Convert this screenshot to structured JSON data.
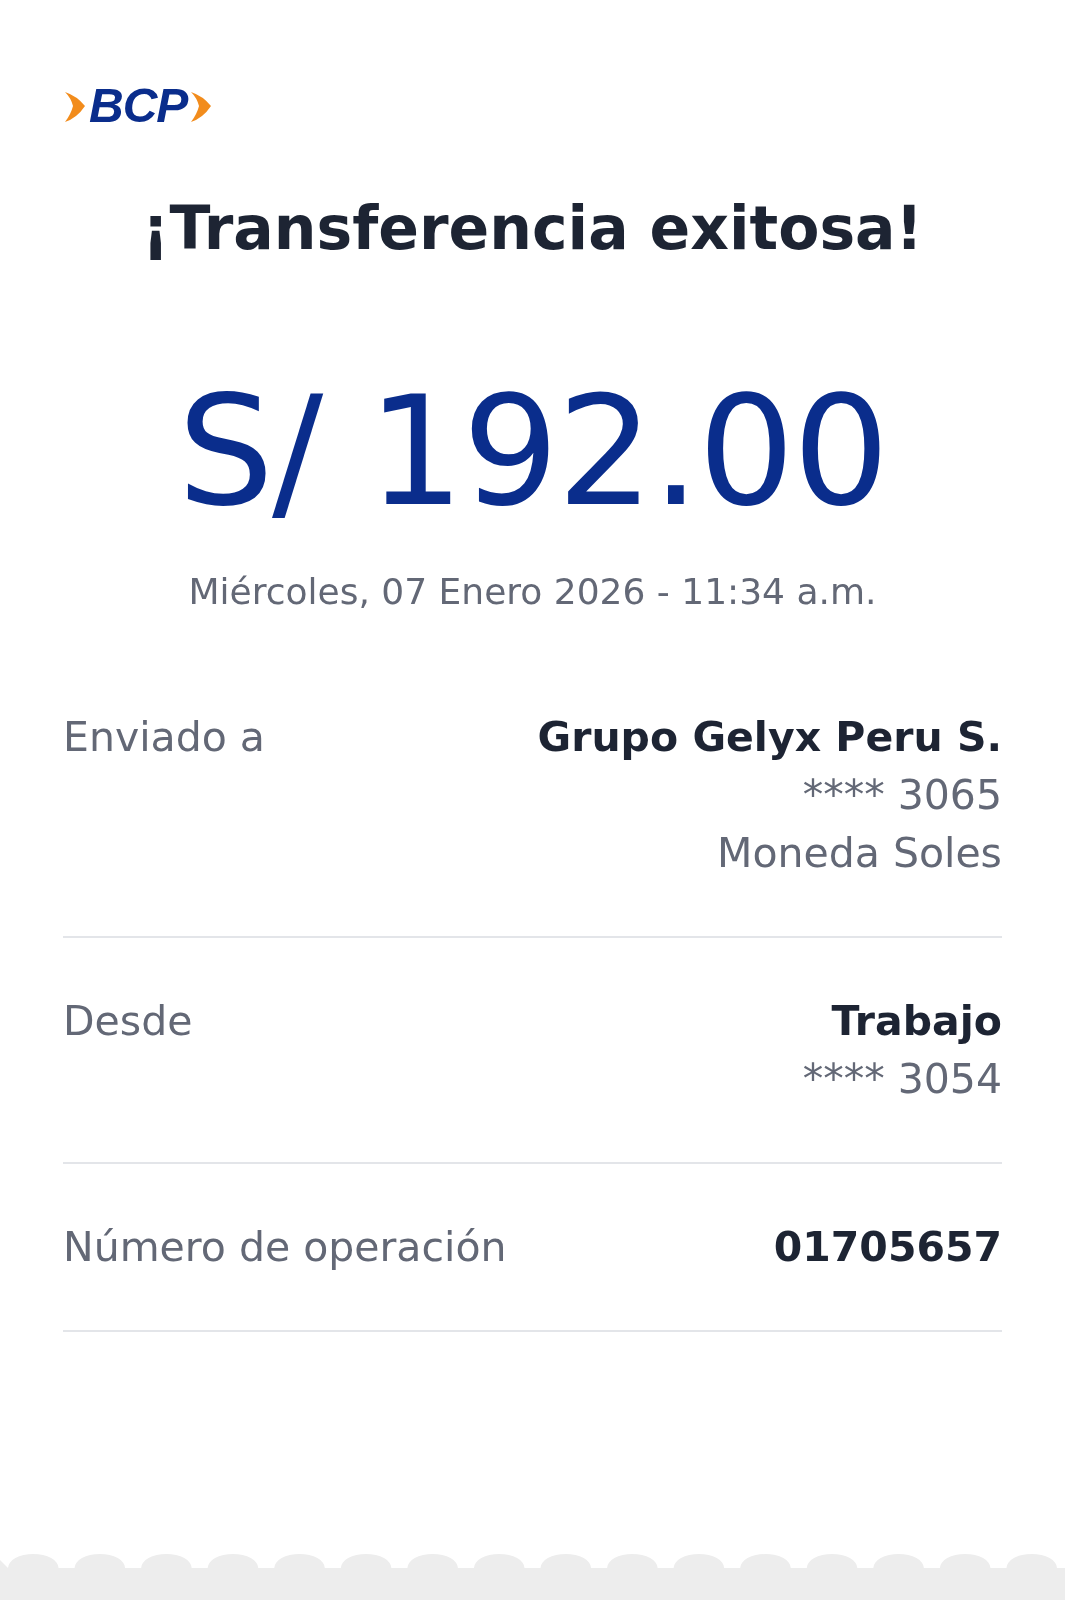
{
  "logo": {
    "text": "BCP"
  },
  "title": "¡Transferencia exitosa!",
  "amount": "S/ 192.00",
  "datetime": "Miércoles, 07 Enero 2026 - 11:34 a.m.",
  "details": [
    {
      "label": "Enviado a",
      "lines": [
        {
          "text": "Grupo Gelyx Peru S.",
          "kind": "strong"
        },
        {
          "text": "**** 3065",
          "kind": "muted"
        },
        {
          "text": "Moneda Soles",
          "kind": "muted"
        }
      ]
    },
    {
      "label": "Desde",
      "lines": [
        {
          "text": "Trabajo",
          "kind": "strong"
        },
        {
          "text": "**** 3054",
          "kind": "muted"
        }
      ]
    },
    {
      "label": "Número de operación",
      "lines": [
        {
          "text": "01705657",
          "kind": "strong"
        }
      ]
    }
  ]
}
